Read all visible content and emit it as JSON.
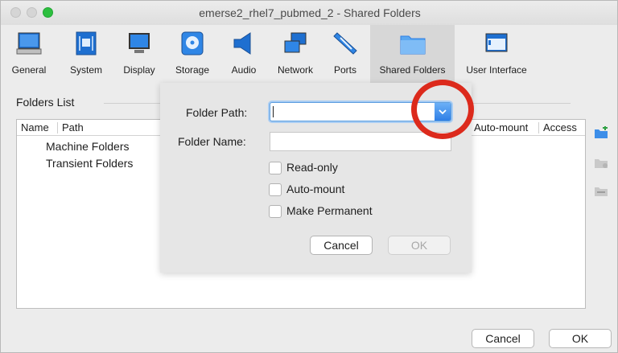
{
  "window": {
    "title": "emerse2_rhel7_pubmed_2 - Shared Folders"
  },
  "toolbar": {
    "items": [
      {
        "label": "General",
        "icon": "monitor-icon"
      },
      {
        "label": "System",
        "icon": "chip-icon"
      },
      {
        "label": "Display",
        "icon": "display-icon"
      },
      {
        "label": "Storage",
        "icon": "disk-icon"
      },
      {
        "label": "Audio",
        "icon": "speaker-icon"
      },
      {
        "label": "Network",
        "icon": "network-icon"
      },
      {
        "label": "Ports",
        "icon": "ports-icon"
      },
      {
        "label": "Shared Folders",
        "icon": "folder-icon",
        "active": true
      },
      {
        "label": "User Interface",
        "icon": "window-icon"
      }
    ]
  },
  "folders": {
    "title": "Folders List",
    "columns": [
      "Name",
      "Path",
      "Auto-mount",
      "Access"
    ],
    "rows": [
      "Machine Folders",
      "Transient Folders"
    ]
  },
  "dialog": {
    "folder_path_label": "Folder Path:",
    "folder_path_value": "",
    "folder_name_label": "Folder Name:",
    "folder_name_value": "",
    "options": [
      "Read-only",
      "Auto-mount",
      "Make Permanent"
    ],
    "cancel_label": "Cancel",
    "ok_label": "OK"
  },
  "footer": {
    "cancel_label": "Cancel",
    "ok_label": "OK"
  },
  "colors": {
    "accent": "#2f7fe6",
    "annotation": "#dc2a1c"
  }
}
